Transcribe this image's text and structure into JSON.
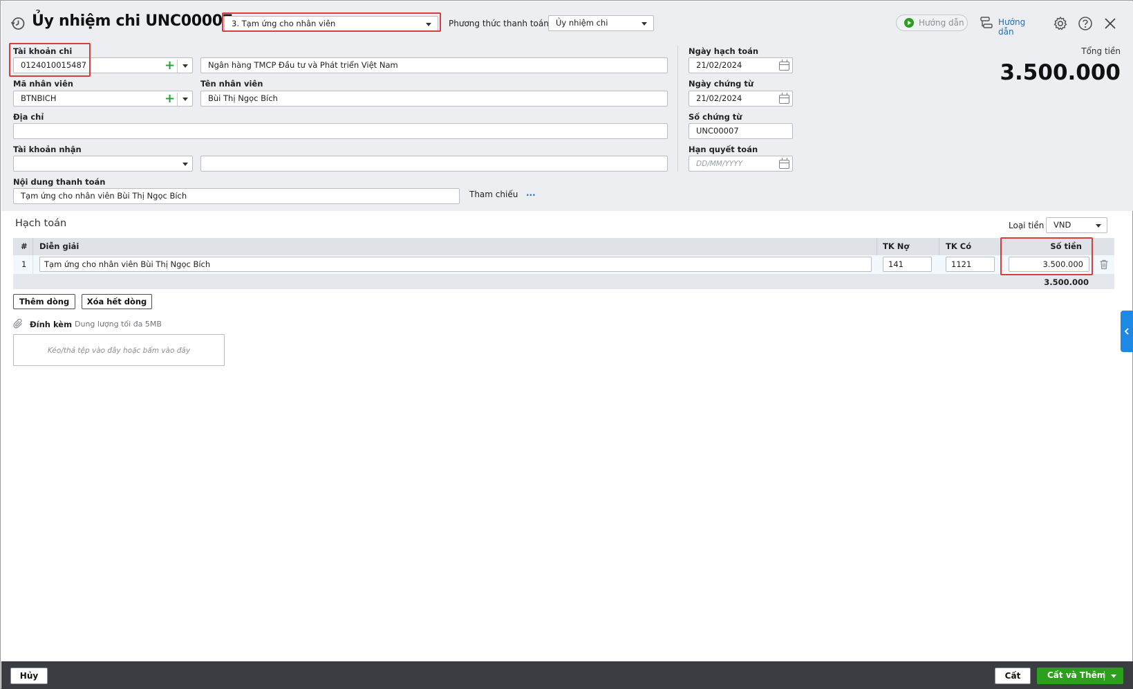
{
  "header": {
    "title": "Ủy nhiệm chi UNC00007",
    "purpose_select": "3. Tạm ứng cho nhân viên",
    "payment_method_label": "Phương thức thanh toán",
    "payment_method_value": "Ủy nhiệm chi",
    "guide_video_label": "Hướng dẫn",
    "guide_label": "Hướng dẫn"
  },
  "form": {
    "account_label": "Tài khoản chi",
    "account_value": "0124010015487",
    "bank_name": "Ngân hàng TMCP Đầu tư và Phát triển Việt Nam",
    "employee_code_label": "Mã nhân viên",
    "employee_code_value": "BTNBICH",
    "employee_name_label": "Tên nhân viên",
    "employee_name_value": "Bùi Thị Ngọc Bích",
    "address_label": "Địa chỉ",
    "address_value": "",
    "receive_account_label": "Tài khoản nhận",
    "receive_account_value": "",
    "receive_bank_value": "",
    "content_label": "Nội dung thanh toán",
    "content_value": "Tạm ứng cho nhân viên Bùi Thị Ngọc Bích",
    "reference_label": "Tham chiếu",
    "reference_more": "..."
  },
  "dates": {
    "posting_date_label": "Ngày hạch toán",
    "posting_date_value": "21/02/2024",
    "voucher_date_label": "Ngày chứng từ",
    "voucher_date_value": "21/02/2024",
    "voucher_no_label": "Số chứng từ",
    "voucher_no_value": "UNC00007",
    "due_date_label": "Hạn quyết toán",
    "due_date_placeholder": "DD/MM/YYYY"
  },
  "total": {
    "label": "Tổng tiền",
    "value": "3.500.000"
  },
  "accounting": {
    "section_title": "Hạch toán",
    "currency_label": "Loại tiền",
    "currency_value": "VND",
    "columns": [
      "#",
      "Diễn giải",
      "TK Nợ",
      "TK Có",
      "Số tiền"
    ],
    "rows": [
      {
        "no": "1",
        "description": "Tạm ứng cho nhân viên Bùi Thị Ngọc Bích",
        "debit": "141",
        "credit": "1121",
        "amount": "3.500.000"
      }
    ],
    "sum": "3.500.000",
    "add_row_label": "Thêm dòng",
    "clear_rows_label": "Xóa hết dòng"
  },
  "attachment": {
    "label": "Đính kèm",
    "hint": "Dung lượng tối đa 5MB",
    "dropzone_text": "Kéo/thả tệp vào đây hoặc bấm vào đây"
  },
  "footer": {
    "cancel_label": "Hủy",
    "save_label": "Cất",
    "save_add_label": "Cất và Thêm"
  },
  "colors": {
    "accent_red": "#d83d3d",
    "green": "#2ca01c",
    "panel_bg": "#eceef1",
    "footer_bg": "#3a3d42",
    "side_tab": "#1e88e5"
  }
}
